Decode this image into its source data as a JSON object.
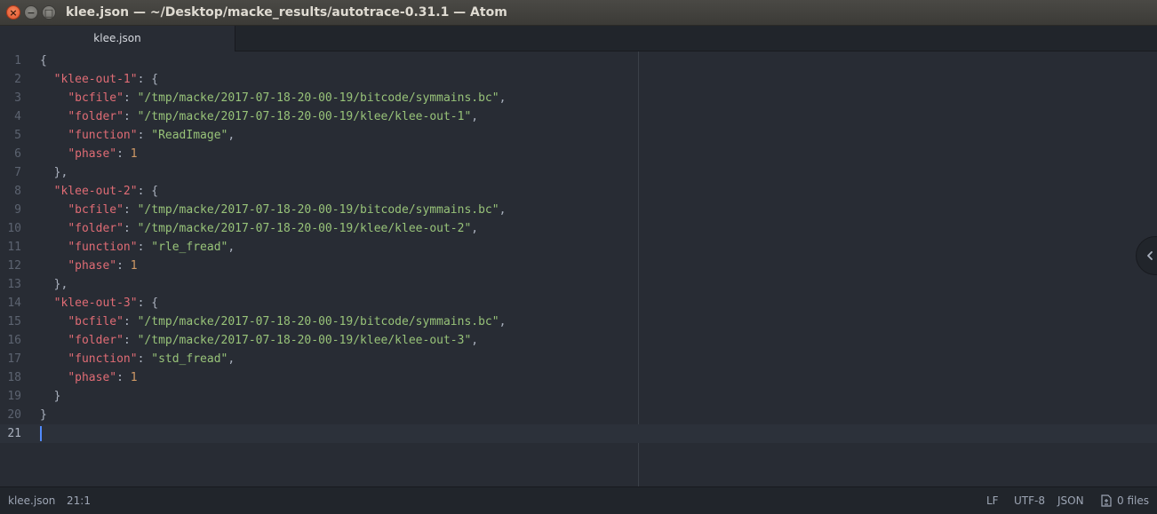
{
  "window": {
    "title": "klee.json — ~/Desktop/macke_results/autotrace-0.31.1 — Atom",
    "close_glyph": "×",
    "minimize_glyph": "−",
    "maximize_glyph": "□"
  },
  "tabs": [
    {
      "label": "klee.json",
      "active": true
    }
  ],
  "editor": {
    "lines": [
      {
        "num": "1",
        "indent": "",
        "tokens": [
          {
            "t": "pun",
            "v": "{"
          }
        ]
      },
      {
        "num": "2",
        "indent": "  ",
        "tokens": [
          {
            "t": "key",
            "v": "\"klee-out-1\""
          },
          {
            "t": "pun",
            "v": ": {"
          }
        ]
      },
      {
        "num": "3",
        "indent": "    ",
        "tokens": [
          {
            "t": "key",
            "v": "\"bcfile\""
          },
          {
            "t": "pun",
            "v": ": "
          },
          {
            "t": "str",
            "v": "\"/tmp/macke/2017-07-18-20-00-19/bitcode/symmains.bc\""
          },
          {
            "t": "pun",
            "v": ","
          }
        ]
      },
      {
        "num": "4",
        "indent": "    ",
        "tokens": [
          {
            "t": "key",
            "v": "\"folder\""
          },
          {
            "t": "pun",
            "v": ": "
          },
          {
            "t": "str",
            "v": "\"/tmp/macke/2017-07-18-20-00-19/klee/klee-out-1\""
          },
          {
            "t": "pun",
            "v": ","
          }
        ]
      },
      {
        "num": "5",
        "indent": "    ",
        "tokens": [
          {
            "t": "key",
            "v": "\"function\""
          },
          {
            "t": "pun",
            "v": ": "
          },
          {
            "t": "str",
            "v": "\"ReadImage\""
          },
          {
            "t": "pun",
            "v": ","
          }
        ]
      },
      {
        "num": "6",
        "indent": "    ",
        "tokens": [
          {
            "t": "key",
            "v": "\"phase\""
          },
          {
            "t": "pun",
            "v": ": "
          },
          {
            "t": "num",
            "v": "1"
          }
        ]
      },
      {
        "num": "7",
        "indent": "  ",
        "tokens": [
          {
            "t": "pun",
            "v": "},"
          }
        ]
      },
      {
        "num": "8",
        "indent": "  ",
        "tokens": [
          {
            "t": "key",
            "v": "\"klee-out-2\""
          },
          {
            "t": "pun",
            "v": ": {"
          }
        ]
      },
      {
        "num": "9",
        "indent": "    ",
        "tokens": [
          {
            "t": "key",
            "v": "\"bcfile\""
          },
          {
            "t": "pun",
            "v": ": "
          },
          {
            "t": "str",
            "v": "\"/tmp/macke/2017-07-18-20-00-19/bitcode/symmains.bc\""
          },
          {
            "t": "pun",
            "v": ","
          }
        ]
      },
      {
        "num": "10",
        "indent": "    ",
        "tokens": [
          {
            "t": "key",
            "v": "\"folder\""
          },
          {
            "t": "pun",
            "v": ": "
          },
          {
            "t": "str",
            "v": "\"/tmp/macke/2017-07-18-20-00-19/klee/klee-out-2\""
          },
          {
            "t": "pun",
            "v": ","
          }
        ]
      },
      {
        "num": "11",
        "indent": "    ",
        "tokens": [
          {
            "t": "key",
            "v": "\"function\""
          },
          {
            "t": "pun",
            "v": ": "
          },
          {
            "t": "str",
            "v": "\"rle_fread\""
          },
          {
            "t": "pun",
            "v": ","
          }
        ]
      },
      {
        "num": "12",
        "indent": "    ",
        "tokens": [
          {
            "t": "key",
            "v": "\"phase\""
          },
          {
            "t": "pun",
            "v": ": "
          },
          {
            "t": "num",
            "v": "1"
          }
        ]
      },
      {
        "num": "13",
        "indent": "  ",
        "tokens": [
          {
            "t": "pun",
            "v": "},"
          }
        ]
      },
      {
        "num": "14",
        "indent": "  ",
        "tokens": [
          {
            "t": "key",
            "v": "\"klee-out-3\""
          },
          {
            "t": "pun",
            "v": ": {"
          }
        ]
      },
      {
        "num": "15",
        "indent": "    ",
        "tokens": [
          {
            "t": "key",
            "v": "\"bcfile\""
          },
          {
            "t": "pun",
            "v": ": "
          },
          {
            "t": "str",
            "v": "\"/tmp/macke/2017-07-18-20-00-19/bitcode/symmains.bc\""
          },
          {
            "t": "pun",
            "v": ","
          }
        ]
      },
      {
        "num": "16",
        "indent": "    ",
        "tokens": [
          {
            "t": "key",
            "v": "\"folder\""
          },
          {
            "t": "pun",
            "v": ": "
          },
          {
            "t": "str",
            "v": "\"/tmp/macke/2017-07-18-20-00-19/klee/klee-out-3\""
          },
          {
            "t": "pun",
            "v": ","
          }
        ]
      },
      {
        "num": "17",
        "indent": "    ",
        "tokens": [
          {
            "t": "key",
            "v": "\"function\""
          },
          {
            "t": "pun",
            "v": ": "
          },
          {
            "t": "str",
            "v": "\"std_fread\""
          },
          {
            "t": "pun",
            "v": ","
          }
        ]
      },
      {
        "num": "18",
        "indent": "    ",
        "tokens": [
          {
            "t": "key",
            "v": "\"phase\""
          },
          {
            "t": "pun",
            "v": ": "
          },
          {
            "t": "num",
            "v": "1"
          }
        ]
      },
      {
        "num": "19",
        "indent": "  ",
        "tokens": [
          {
            "t": "pun",
            "v": "}"
          }
        ]
      },
      {
        "num": "20",
        "indent": "",
        "tokens": [
          {
            "t": "pun",
            "v": "}"
          }
        ]
      },
      {
        "num": "21",
        "indent": "",
        "tokens": [],
        "cursor": true
      }
    ]
  },
  "status": {
    "file_name": "klee.json",
    "cursor_position": "21:1",
    "line_ending": "LF",
    "encoding": "UTF-8",
    "grammar": "JSON",
    "files_count": "0 files"
  },
  "colors": {
    "editor_bg": "#282c34",
    "key": "#e06c75",
    "string": "#98c379",
    "number": "#d19a66",
    "cursor": "#528bff"
  }
}
